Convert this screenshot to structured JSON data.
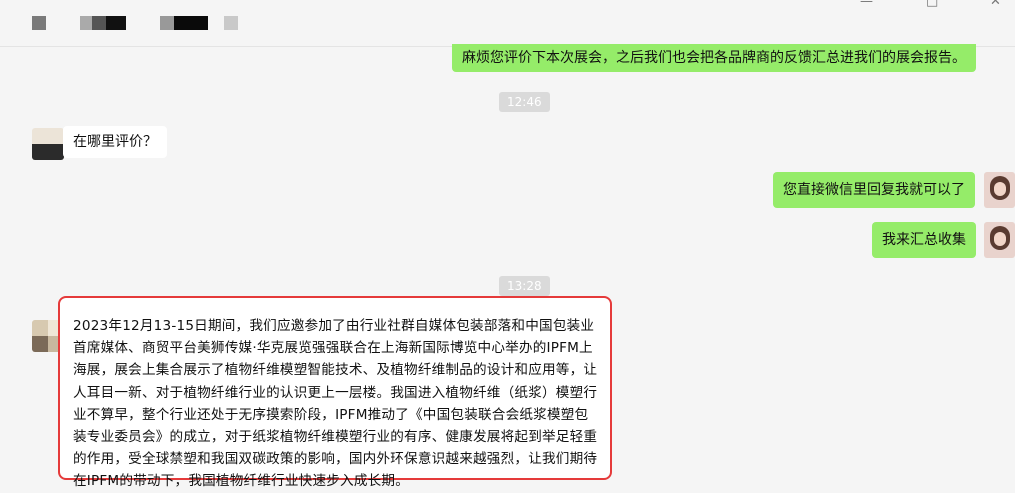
{
  "window": {
    "controls": {
      "minimize": "—",
      "maximize": "□",
      "close": "✕"
    }
  },
  "chat": {
    "messages": [
      {
        "id": "m1",
        "side": "right",
        "text": "麻烦您评价下本次展会，之后我们也会把各品牌商的反馈汇总进我们的展会报告。"
      },
      {
        "id": "t1",
        "type": "time",
        "text": "12:46"
      },
      {
        "id": "m2",
        "side": "left",
        "text": "在哪里评价？"
      },
      {
        "id": "m3",
        "side": "right",
        "text": "您直接微信里回复我就可以了"
      },
      {
        "id": "m4",
        "side": "right",
        "text": "我来汇总收集"
      },
      {
        "id": "t2",
        "type": "time",
        "text": "13:28"
      },
      {
        "id": "m5",
        "side": "left",
        "text": "2023年12月13-15日期间，我们应邀参加了由行业社群自媒体包装部落和中国包装业首席媒体、商贸平台美狮传媒·华克展览强强联合在上海新国际博览中心举办的IPFM上海展，展会上集合展示了植物纤维模塑智能技术、及植物纤维制品的设计和应用等，让人耳目一新、对于植物纤维行业的认识更上一层楼。我国进入植物纤维（纸浆）模塑行业不算早，整个行业还处于无序摸索阶段，IPFM推动了《中国包装联合会纸浆模塑包装专业委员会》的成立，对于纸浆植物纤维模塑行业的有序、健康发展将起到举足轻重的作用，受全球禁塑和我国双碳政策的影响，国内外环保意识越来越强烈，让我们期待在IPFM的带动下，我国植物纤维行业快速步入成长期。"
      }
    ]
  },
  "colors": {
    "sent_bubble": "#95ec69",
    "received_bubble": "#ffffff",
    "highlight_border": "#e53a3a",
    "background": "#f5f5f5"
  }
}
